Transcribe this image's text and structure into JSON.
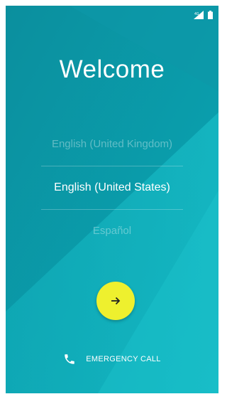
{
  "status_bar": {
    "icons": [
      "signal-icon",
      "battery-icon"
    ]
  },
  "welcome": {
    "title": "Welcome"
  },
  "languages": {
    "items": [
      {
        "label": "English (United Kingdom)",
        "selected": false
      },
      {
        "label": "English (United States)",
        "selected": true
      },
      {
        "label": "Español",
        "selected": false
      }
    ]
  },
  "next_button": {
    "icon": "arrow-right-icon",
    "color": "#eef02e"
  },
  "emergency": {
    "label": "EMERGENCY CALL",
    "icon": "phone-icon"
  },
  "colors": {
    "background": "#0aa2b0",
    "accent": "#eef02e"
  }
}
